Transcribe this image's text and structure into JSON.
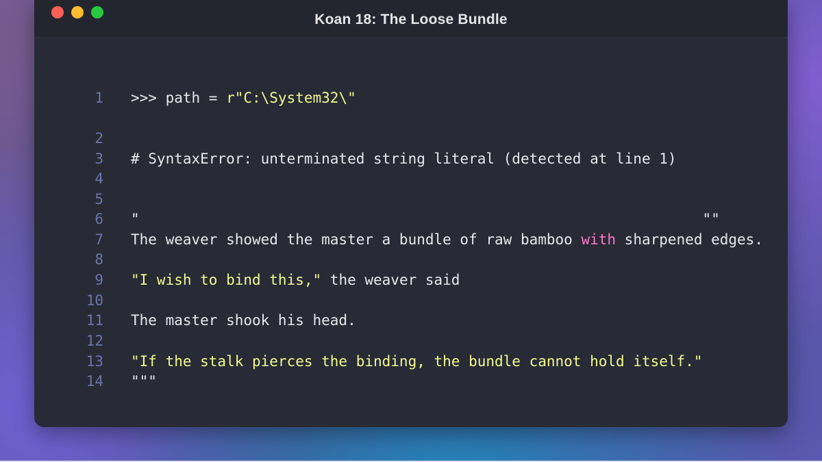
{
  "window": {
    "title": "Koan 18: The Loose Bundle"
  },
  "colors": {
    "editor_bg": "#282a36",
    "line_number": "#6b76a8",
    "text": "#e8e8ee",
    "string": "#f1fa8c",
    "keyword": "#ff79c6"
  },
  "editor": {
    "lines": [
      {
        "n": "1",
        "parts": [
          {
            "t": ">>> path = ",
            "c": "plain"
          },
          {
            "t": "r\"C:\\System32\\\"",
            "c": "str"
          }
        ]
      },
      {
        "n": "2",
        "parts": []
      },
      {
        "n": "3",
        "parts": [
          {
            "t": "# SyntaxError: unterminated string literal (detected at line 1)",
            "c": "plain"
          }
        ]
      },
      {
        "n": "4",
        "parts": []
      },
      {
        "n": "5",
        "parts": []
      },
      {
        "n": "6",
        "parts": [
          {
            "t": "\"                                                                 \"\"",
            "c": "plain"
          }
        ]
      },
      {
        "n": "7",
        "parts": [
          {
            "t": "The weaver showed the master a bundle of raw bamboo ",
            "c": "plain"
          },
          {
            "t": "with",
            "c": "kw"
          },
          {
            "t": " sharpened edges.",
            "c": "plain"
          }
        ]
      },
      {
        "n": "8",
        "parts": []
      },
      {
        "n": "9",
        "parts": [
          {
            "t": "\"I wish to bind this,\"",
            "c": "str"
          },
          {
            "t": " the weaver said",
            "c": "plain"
          }
        ]
      },
      {
        "n": "10",
        "parts": []
      },
      {
        "n": "11",
        "parts": [
          {
            "t": "The master shook his head.",
            "c": "plain"
          }
        ]
      },
      {
        "n": "12",
        "parts": []
      },
      {
        "n": "13",
        "parts": [
          {
            "t": "\"If the stalk pierces the binding, the bundle cannot hold itself.\"",
            "c": "str"
          }
        ]
      },
      {
        "n": "14",
        "parts": [
          {
            "t": "\"\"\"",
            "c": "plain"
          }
        ]
      }
    ]
  }
}
